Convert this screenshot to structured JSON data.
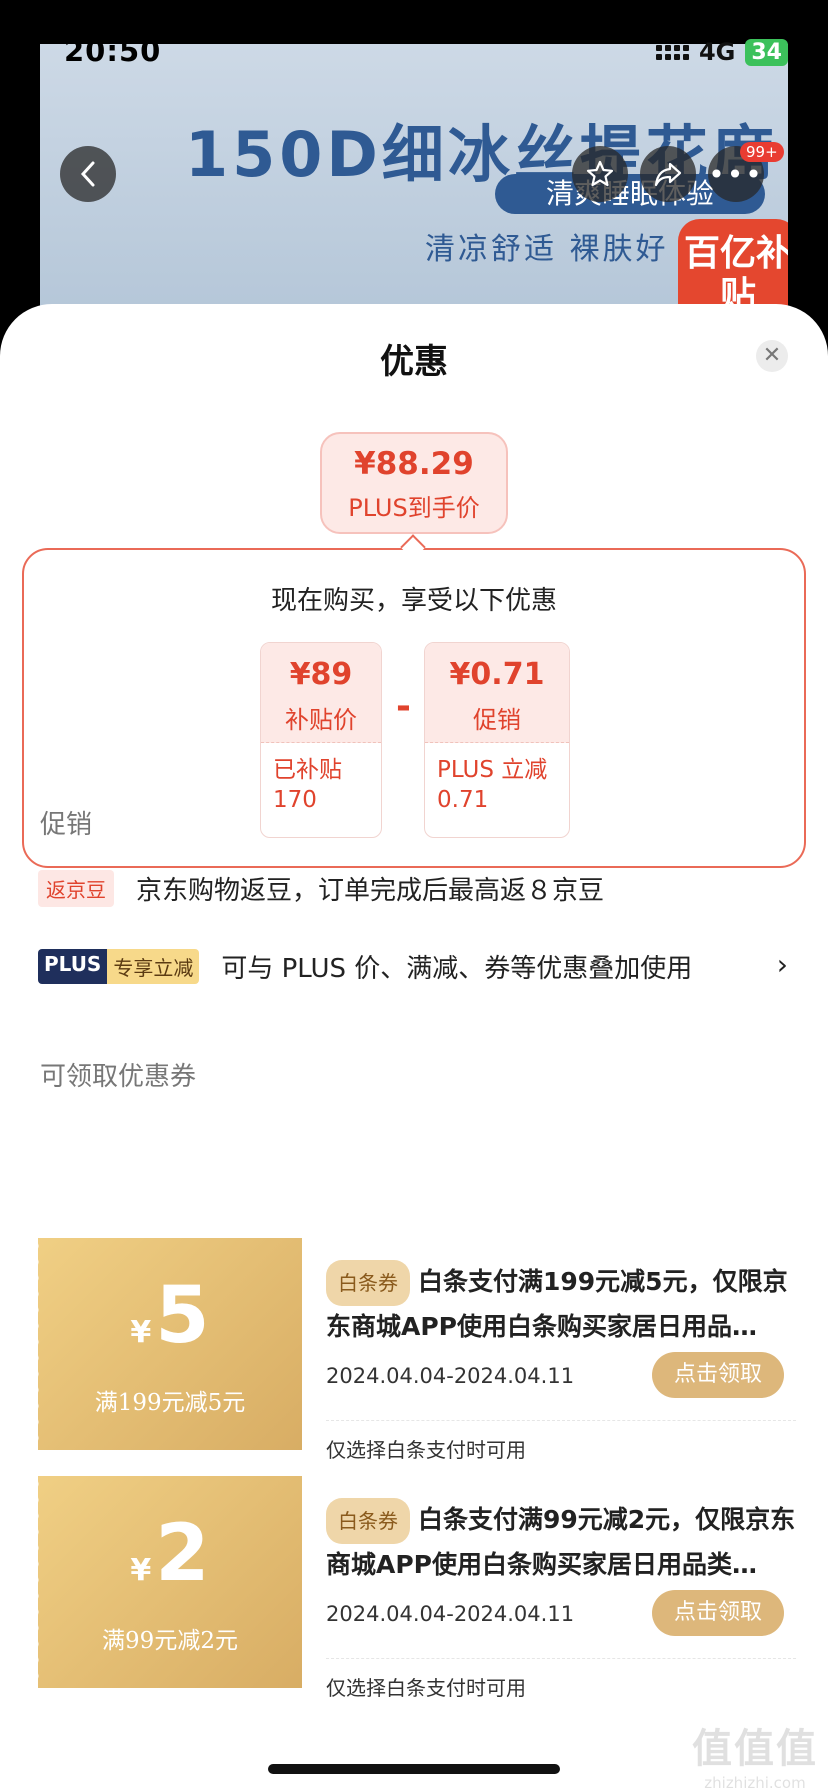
{
  "status_bar": {
    "time": "20:50",
    "network": "4G",
    "battery": "34"
  },
  "banner": {
    "title": "150D细冰丝提花席",
    "subtitle_pill": "清爽睡眠体验",
    "subtitle": "清凉舒适 裸肤好",
    "badge": "百亿补贴",
    "more_count": "99+"
  },
  "sheet": {
    "title": "优惠",
    "plus_price": {
      "amount": "¥88.29",
      "label": "PLUS到手价"
    },
    "breakdown": {
      "title": "现在购买，享受以下优惠",
      "subsidy": {
        "value": "¥89",
        "label": "补贴价",
        "detail_label": "已补贴",
        "detail_value": "170"
      },
      "operator": "-",
      "promo": {
        "value": "¥0.71",
        "label": "促销",
        "detail_label": "PLUS 立减",
        "detail_value": "0.71"
      }
    },
    "promotions": {
      "heading": "促销",
      "items": [
        {
          "tag": "返京豆",
          "text": "京东购物返豆，订单完成后最高返８京豆"
        },
        {
          "tag_a": "PLUS",
          "tag_b": "专享立减",
          "text": "可与 PLUS 价、满减、券等优惠叠加使用",
          "chevron": "›"
        }
      ]
    },
    "coupons": {
      "heading": "可领取优惠券",
      "items": [
        {
          "yen": "¥",
          "amount": "5",
          "condition": "满199元减5元",
          "tag": "白条券",
          "description": "白条支付满199元减5元，仅限京东商城APP使用白条购买家居日用品…",
          "date_range": "2024.04.04-2024.04.11",
          "button": "点击领取",
          "note": "仅选择白条支付时可用"
        },
        {
          "yen": "¥",
          "amount": "2",
          "condition": "满99元减2元",
          "tag": "白条券",
          "description": "白条支付满99元减2元，仅限京东商城APP使用白条购买家居日用品类…",
          "date_range": "2024.04.04-2024.04.11",
          "button": "点击领取",
          "note": "仅选择白条支付时可用"
        }
      ]
    }
  },
  "watermark": {
    "big": "值值值",
    "small": "zhizhizhi.com"
  }
}
